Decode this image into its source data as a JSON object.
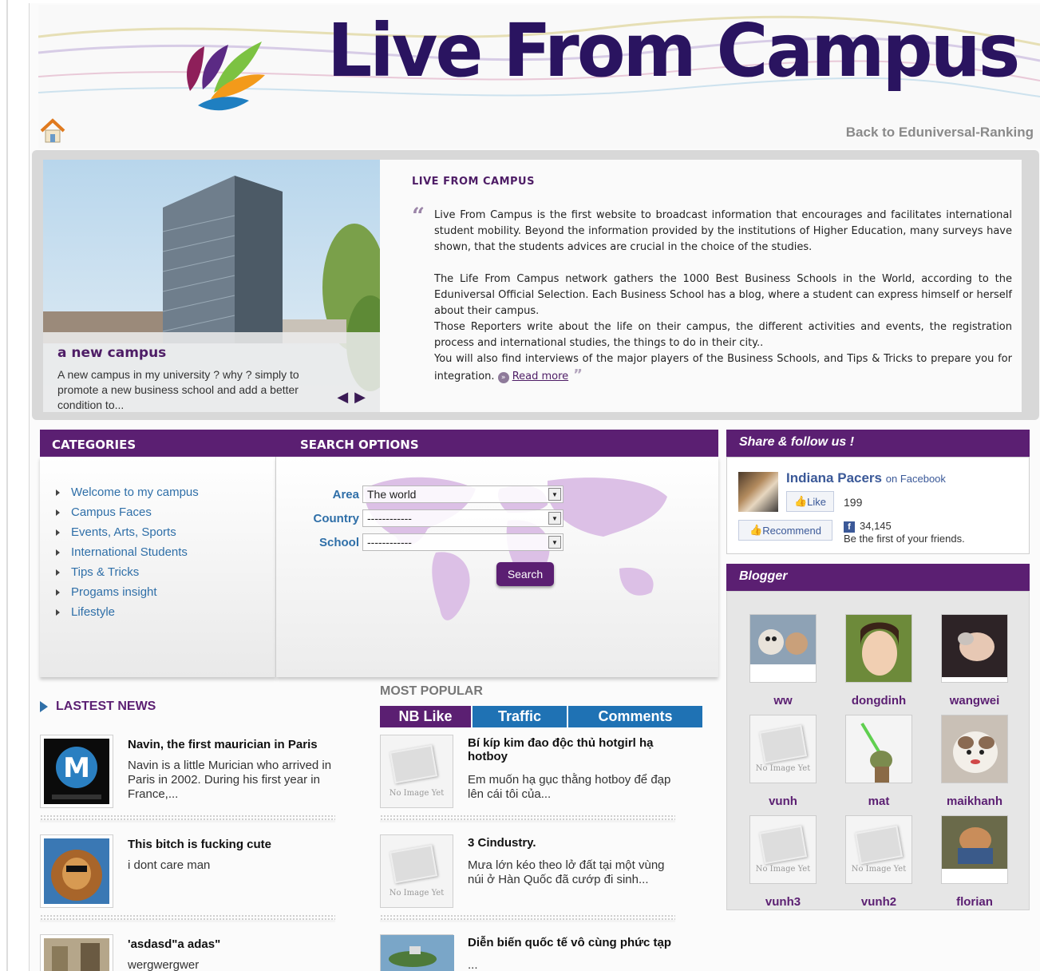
{
  "header": {
    "site_title": "Live From Campus",
    "back_link": "Back to Eduniversal-Ranking"
  },
  "featured": {
    "slide_title": "a new campus",
    "slide_text": "A new campus in my university ? why ? simply to promote a new business school and add a better condition to...",
    "about_heading": "LIVE FROM CAMPUS",
    "paragraph_1": "Live From Campus is the first website to broadcast information that encourages and facilitates international student mobility. Beyond the information provided by the institutions of Higher Education, many surveys have shown, that the students advices are crucial in the choice of the studies.",
    "paragraph_2": "The Life From Campus network gathers the 1000 Best Business Schools in the World, according to the Eduniversal Official Selection. Each Business School has a blog, where a student can express himself or herself about their campus.",
    "paragraph_3": "Those Reporters write about the life on their campus, the different activities and events, the registration process and international studies, the things to do in their city..",
    "paragraph_4": "You will also find interviews of the major players of the Business Schools, and Tips & Tricks to prepare you for integration.",
    "read_more": "Read more"
  },
  "categories": {
    "heading": "CATEGORIES",
    "items": [
      "Welcome to my campus",
      "Campus Faces",
      "Events, Arts, Sports",
      "International Students",
      "Tips & Tricks",
      "Progams insight",
      "Lifestyle"
    ]
  },
  "search": {
    "heading": "SEARCH OPTIONS",
    "area_label": "Area",
    "area_value": "The world",
    "country_label": "Country",
    "country_value": "------------",
    "school_label": "School",
    "school_value": "------------",
    "button": "Search"
  },
  "share": {
    "heading": "Share & follow us !",
    "page_name": "Indiana Pacers",
    "on_facebook": "on Facebook",
    "like": "Like",
    "like_count": "199",
    "recommend": "Recommend",
    "recommend_count": "34,145",
    "friends_text": "Be the first of your friends."
  },
  "blogger": {
    "heading": "Blogger",
    "no_image_text": "No Image Yet",
    "items": [
      {
        "name": "ww"
      },
      {
        "name": "dongdinh"
      },
      {
        "name": "wangwei"
      },
      {
        "name": "vunh"
      },
      {
        "name": "mat"
      },
      {
        "name": "maikhanh"
      },
      {
        "name": "vunh3"
      },
      {
        "name": "vunh2"
      },
      {
        "name": "florian"
      }
    ]
  },
  "latest_news": {
    "heading": "LASTEST NEWS",
    "items": [
      {
        "title": "Navin, the first maurician in Paris",
        "text": "Navin is a little Murician who arrived in Paris in 2002. During his first year in France,..."
      },
      {
        "title": "This bitch is fucking cute",
        "text": "i dont care man"
      },
      {
        "title": "'asdasd\"a adas\"",
        "text": "wergwergwer"
      }
    ]
  },
  "most_popular": {
    "heading": "MOST POPULAR",
    "no_image_text": "No Image Yet",
    "tabs": [
      "NB Like",
      "Traffic",
      "Comments"
    ],
    "items": [
      {
        "title": "Bí kíp kim đao độc thủ hotgirl hạ hotboy",
        "text": "Em muốn hạ gục thằng hotboy để đạp lên cái tôi của..."
      },
      {
        "title": "3 Cindustry.",
        "text": "Mưa lớn kéo theo lở đất tại một vùng núi ở Hàn Quốc đã cướp đi sinh..."
      },
      {
        "title": "Diễn biến quốc tế vô cùng phức tạp",
        "text": "..."
      }
    ]
  },
  "colors": {
    "brand_purple": "#5b1f72",
    "link_blue": "#2f6fa8",
    "tab_blue": "#1f72b4"
  }
}
